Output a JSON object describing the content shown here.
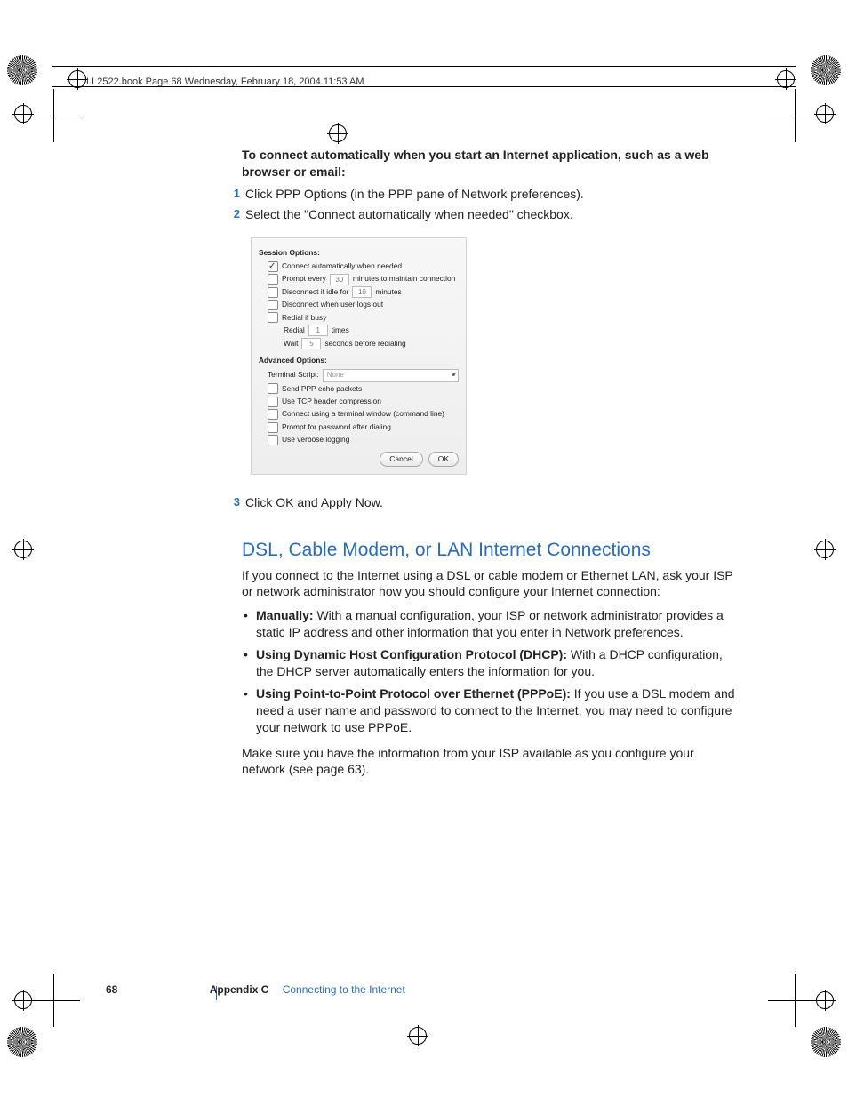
{
  "header_line": "LL2522.book  Page 68  Wednesday, February 18, 2004  11:53 AM",
  "intro_heading": "To connect automatically when you start an Internet application, such as a web browser or email:",
  "steps_a": [
    "Click PPP Options (in the PPP pane of Network preferences).",
    "Select the \"Connect automatically when needed\" checkbox."
  ],
  "steps_b": [
    "Click OK and Apply Now."
  ],
  "dialog": {
    "session_label": "Session Options:",
    "row1": "Connect automatically when needed",
    "row2a": "Prompt every",
    "row2_val": "30",
    "row2b": "minutes to maintain connection",
    "row3a": "Disconnect if idle for",
    "row3_val": "10",
    "row3b": "minutes",
    "row4": "Disconnect when user logs out",
    "row5": "Redial if busy",
    "row6a": "Redial",
    "row6_val": "1",
    "row6b": "times",
    "row7a": "Wait",
    "row7_val": "5",
    "row7b": "seconds before redialing",
    "adv_label": "Advanced Options:",
    "term_label": "Terminal Script:",
    "term_val": "None",
    "adv1": "Send PPP echo packets",
    "adv2": "Use TCP header compression",
    "adv3": "Connect using a terminal window (command line)",
    "adv4": "Prompt for password after dialing",
    "adv5": "Use verbose logging",
    "cancel": "Cancel",
    "ok": "OK"
  },
  "section_heading": "DSL, Cable Modem, or LAN Internet Connections",
  "para1": "If you connect to the Internet using a DSL or cable modem or Ethernet LAN, ask your ISP or network administrator how you should configure your Internet connection:",
  "bullets": [
    {
      "bold": "Manually:",
      "text": "  With a manual configuration, your ISP or network administrator provides a static IP address and other information that you enter in Network preferences."
    },
    {
      "bold": "Using Dynamic Host Configuration Protocol (DHCP):",
      "text": "  With a DHCP configuration, the DHCP server automatically enters the information for you."
    },
    {
      "bold": "Using Point-to-Point Protocol over Ethernet (PPPoE):",
      "text": "  If you use a DSL modem and need a user name and password to connect to the Internet, you may need to configure your network to use PPPoE."
    }
  ],
  "para2": "Make sure you have the information from your ISP available as you configure your network (see page 63).",
  "footer": {
    "page": "68",
    "appendix": "Appendix C",
    "title": "Connecting to the Internet"
  }
}
